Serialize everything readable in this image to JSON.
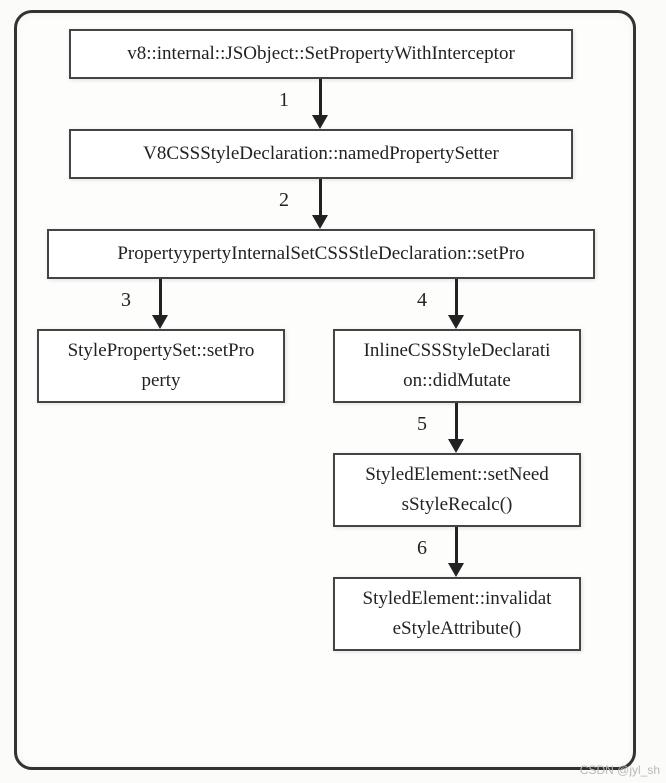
{
  "nodes": {
    "n1": "v8::internal::JSObject::SetPropertyWithInterceptor",
    "n2": "V8CSSStyleDeclaration::namedPropertySetter",
    "n3": "PropertyypertyInternalSetCSSStleDeclaration::setPro",
    "n4": "StylePropertySet::setPro perty",
    "n5": "InlineCSSStyleDeclarati on::didMutate",
    "n6": "StyledElement::setNeed sStyleRecalc()",
    "n7": "StyledElement::invalidat eStyleAttribute()"
  },
  "edges": {
    "e1": "1",
    "e2": "2",
    "e3": "3",
    "e4": "4",
    "e5": "5",
    "e6": "6"
  },
  "watermark": "CSDN @jyl_sh"
}
